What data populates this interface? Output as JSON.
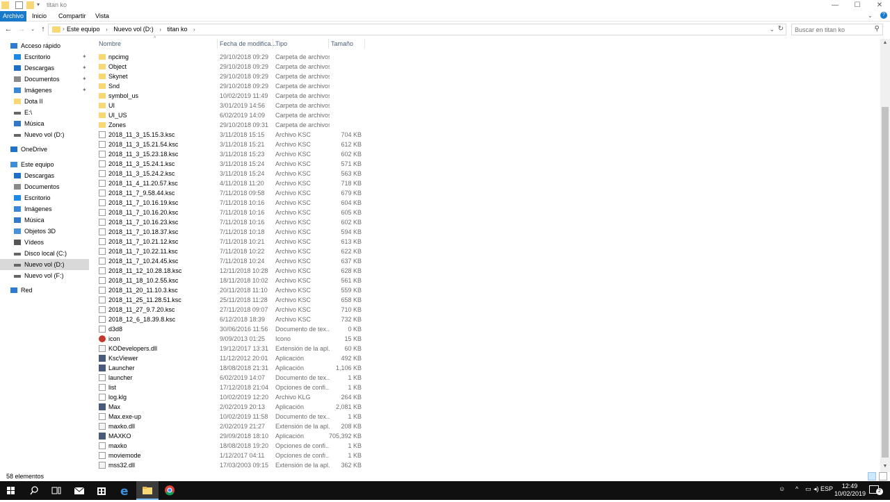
{
  "window": {
    "title": "titan ko",
    "controls": {
      "minimize": "—",
      "maximize": "☐",
      "close": "✕"
    }
  },
  "ribbon": {
    "tabs": [
      "Archivo",
      "Inicio",
      "Compartir",
      "Vista"
    ]
  },
  "address": {
    "crumbs": [
      "Este equipo",
      "Nuevo vol (D:)",
      "titan ko"
    ],
    "separator": "›"
  },
  "search": {
    "placeholder": "Buscar en titan ko"
  },
  "nav": {
    "items": [
      {
        "label": "Acceso rápido",
        "icon": "star-icon",
        "pinned": false
      },
      {
        "label": "Escritorio",
        "icon": "desktop-icon",
        "pinned": true
      },
      {
        "label": "Descargas",
        "icon": "download-icon",
        "pinned": true
      },
      {
        "label": "Documentos",
        "icon": "document-icon",
        "pinned": true
      },
      {
        "label": "Imágenes",
        "icon": "pictures-icon",
        "pinned": true
      },
      {
        "label": "Dota II",
        "icon": "folder-icon",
        "pinned": false
      },
      {
        "label": "E:\\",
        "icon": "drive-icon",
        "pinned": false
      },
      {
        "label": "Música",
        "icon": "music-icon",
        "pinned": false
      },
      {
        "label": "Nuevo vol (D:)",
        "icon": "drive-icon",
        "pinned": false
      },
      {
        "label": "OneDrive",
        "icon": "cloud-icon",
        "pinned": false
      },
      {
        "label": "Este equipo",
        "icon": "computer-icon",
        "pinned": false
      },
      {
        "label": "Descargas",
        "icon": "download-icon",
        "pinned": false
      },
      {
        "label": "Documentos",
        "icon": "document-icon",
        "pinned": false
      },
      {
        "label": "Escritorio",
        "icon": "desktop-icon",
        "pinned": false
      },
      {
        "label": "Imágenes",
        "icon": "pictures-icon",
        "pinned": false
      },
      {
        "label": "Música",
        "icon": "music-icon",
        "pinned": false
      },
      {
        "label": "Objetos 3D",
        "icon": "cube-icon",
        "pinned": false
      },
      {
        "label": "Vídeos",
        "icon": "video-icon",
        "pinned": false
      },
      {
        "label": "Disco local (C:)",
        "icon": "drive-icon",
        "pinned": false
      },
      {
        "label": "Nuevo vol (D:)",
        "icon": "drive-icon",
        "pinned": false,
        "selected": true
      },
      {
        "label": "Nuevo vol (F:)",
        "icon": "drive-icon",
        "pinned": false
      },
      {
        "label": "Red",
        "icon": "network-icon",
        "pinned": false
      }
    ]
  },
  "columns": [
    "Nombre",
    "Fecha de modifica...",
    "Tipo",
    "Tamaño"
  ],
  "files": [
    {
      "name": "npcimg",
      "date": "29/10/2018 09:29",
      "type": "Carpeta de archivos",
      "size": "",
      "icon": "folder"
    },
    {
      "name": "Object",
      "date": "29/10/2018 09:29",
      "type": "Carpeta de archivos",
      "size": "",
      "icon": "folder"
    },
    {
      "name": "Skynet",
      "date": "29/10/2018 09:29",
      "type": "Carpeta de archivos",
      "size": "",
      "icon": "folder"
    },
    {
      "name": "Snd",
      "date": "29/10/2018 09:29",
      "type": "Carpeta de archivos",
      "size": "",
      "icon": "folder"
    },
    {
      "name": "symbol_us",
      "date": "10/02/2019 11:49",
      "type": "Carpeta de archivos",
      "size": "",
      "icon": "folder"
    },
    {
      "name": "UI",
      "date": "3/01/2019 14:56",
      "type": "Carpeta de archivos",
      "size": "",
      "icon": "folder"
    },
    {
      "name": "UI_US",
      "date": "6/02/2019 14:09",
      "type": "Carpeta de archivos",
      "size": "",
      "icon": "folder"
    },
    {
      "name": "Zones",
      "date": "29/10/2018 09:31",
      "type": "Carpeta de archivos",
      "size": "",
      "icon": "folder"
    },
    {
      "name": "2018_11_3_15.15.3.ksc",
      "date": "3/11/2018 15:15",
      "type": "Archivo KSC",
      "size": "704 KB",
      "icon": "file"
    },
    {
      "name": "2018_11_3_15.21.54.ksc",
      "date": "3/11/2018 15:21",
      "type": "Archivo KSC",
      "size": "612 KB",
      "icon": "file"
    },
    {
      "name": "2018_11_3_15.23.18.ksc",
      "date": "3/11/2018 15:23",
      "type": "Archivo KSC",
      "size": "602 KB",
      "icon": "file"
    },
    {
      "name": "2018_11_3_15.24.1.ksc",
      "date": "3/11/2018 15:24",
      "type": "Archivo KSC",
      "size": "571 KB",
      "icon": "file"
    },
    {
      "name": "2018_11_3_15.24.2.ksc",
      "date": "3/11/2018 15:24",
      "type": "Archivo KSC",
      "size": "563 KB",
      "icon": "file"
    },
    {
      "name": "2018_11_4_11.20.57.ksc",
      "date": "4/11/2018 11:20",
      "type": "Archivo KSC",
      "size": "718 KB",
      "icon": "file"
    },
    {
      "name": "2018_11_7_9.58.44.ksc",
      "date": "7/11/2018 09:58",
      "type": "Archivo KSC",
      "size": "679 KB",
      "icon": "file"
    },
    {
      "name": "2018_11_7_10.16.19.ksc",
      "date": "7/11/2018 10:16",
      "type": "Archivo KSC",
      "size": "604 KB",
      "icon": "file"
    },
    {
      "name": "2018_11_7_10.16.20.ksc",
      "date": "7/11/2018 10:16",
      "type": "Archivo KSC",
      "size": "605 KB",
      "icon": "file"
    },
    {
      "name": "2018_11_7_10.16.23.ksc",
      "date": "7/11/2018 10:16",
      "type": "Archivo KSC",
      "size": "602 KB",
      "icon": "file"
    },
    {
      "name": "2018_11_7_10.18.37.ksc",
      "date": "7/11/2018 10:18",
      "type": "Archivo KSC",
      "size": "594 KB",
      "icon": "file"
    },
    {
      "name": "2018_11_7_10.21.12.ksc",
      "date": "7/11/2018 10:21",
      "type": "Archivo KSC",
      "size": "613 KB",
      "icon": "file"
    },
    {
      "name": "2018_11_7_10.22.11.ksc",
      "date": "7/11/2018 10:22",
      "type": "Archivo KSC",
      "size": "622 KB",
      "icon": "file"
    },
    {
      "name": "2018_11_7_10.24.45.ksc",
      "date": "7/11/2018 10:24",
      "type": "Archivo KSC",
      "size": "637 KB",
      "icon": "file"
    },
    {
      "name": "2018_11_12_10.28.18.ksc",
      "date": "12/11/2018 10:28",
      "type": "Archivo KSC",
      "size": "628 KB",
      "icon": "file"
    },
    {
      "name": "2018_11_18_10.2.55.ksc",
      "date": "18/11/2018 10:02",
      "type": "Archivo KSC",
      "size": "561 KB",
      "icon": "file"
    },
    {
      "name": "2018_11_20_11.10.3.ksc",
      "date": "20/11/2018 11:10",
      "type": "Archivo KSC",
      "size": "559 KB",
      "icon": "file"
    },
    {
      "name": "2018_11_25_11.28.51.ksc",
      "date": "25/11/2018 11:28",
      "type": "Archivo KSC",
      "size": "658 KB",
      "icon": "file"
    },
    {
      "name": "2018_11_27_9.7.20.ksc",
      "date": "27/11/2018 09:07",
      "type": "Archivo KSC",
      "size": "710 KB",
      "icon": "file"
    },
    {
      "name": "2018_12_6_18.39.8.ksc",
      "date": "6/12/2018 18:39",
      "type": "Archivo KSC",
      "size": "732 KB",
      "icon": "file"
    },
    {
      "name": "d3d8",
      "date": "30/06/2016 11:56",
      "type": "Documento de tex...",
      "size": "0 KB",
      "icon": "file"
    },
    {
      "name": "icon",
      "date": "9/09/2013 01:25",
      "type": "Icono",
      "size": "15 KB",
      "icon": "icon"
    },
    {
      "name": "KODevelopers.dll",
      "date": "19/12/2017 13:31",
      "type": "Extensión de la apl...",
      "size": "60 KB",
      "icon": "dll"
    },
    {
      "name": "KscViewer",
      "date": "11/12/2012 20:01",
      "type": "Aplicación",
      "size": "492 KB",
      "icon": "app"
    },
    {
      "name": "Launcher",
      "date": "18/08/2018 21:31",
      "type": "Aplicación",
      "size": "1,106 KB",
      "icon": "app"
    },
    {
      "name": "launcher",
      "date": "6/02/2019 14:07",
      "type": "Documento de tex...",
      "size": "1 KB",
      "icon": "file"
    },
    {
      "name": "list",
      "date": "17/12/2018 21:04",
      "type": "Opciones de confi...",
      "size": "1 KB",
      "icon": "config"
    },
    {
      "name": "log.klg",
      "date": "10/02/2019 12:20",
      "type": "Archivo KLG",
      "size": "264 KB",
      "icon": "file"
    },
    {
      "name": "Max",
      "date": "2/02/2019 20:13",
      "type": "Aplicación",
      "size": "2,081 KB",
      "icon": "app"
    },
    {
      "name": "Max.exe-up",
      "date": "10/02/2019 11:58",
      "type": "Documento de tex...",
      "size": "1 KB",
      "icon": "file"
    },
    {
      "name": "maxko.dll",
      "date": "2/02/2019 21:27",
      "type": "Extensión de la apl...",
      "size": "208 KB",
      "icon": "dll"
    },
    {
      "name": "MAXKO",
      "date": "29/09/2018 18:10",
      "type": "Aplicación",
      "size": "705,392 KB",
      "icon": "app"
    },
    {
      "name": "maxko",
      "date": "18/08/2018 19:20",
      "type": "Opciones de confi...",
      "size": "1 KB",
      "icon": "config"
    },
    {
      "name": "moviemode",
      "date": "1/12/2017 04:11",
      "type": "Opciones de confi...",
      "size": "1 KB",
      "icon": "config"
    },
    {
      "name": "mss32.dll",
      "date": "17/03/2003 09:15",
      "type": "Extensión de la apl...",
      "size": "362 KB",
      "icon": "dll"
    }
  ],
  "status": {
    "count": "58 elementos"
  },
  "taskbar": {
    "lang": "ESP",
    "time": "12:49",
    "date": "10/02/2019",
    "notifications": "2"
  },
  "colors": {
    "accent": "#1979ca",
    "folder": "#f8d775",
    "selection": "#d9d9d9"
  }
}
